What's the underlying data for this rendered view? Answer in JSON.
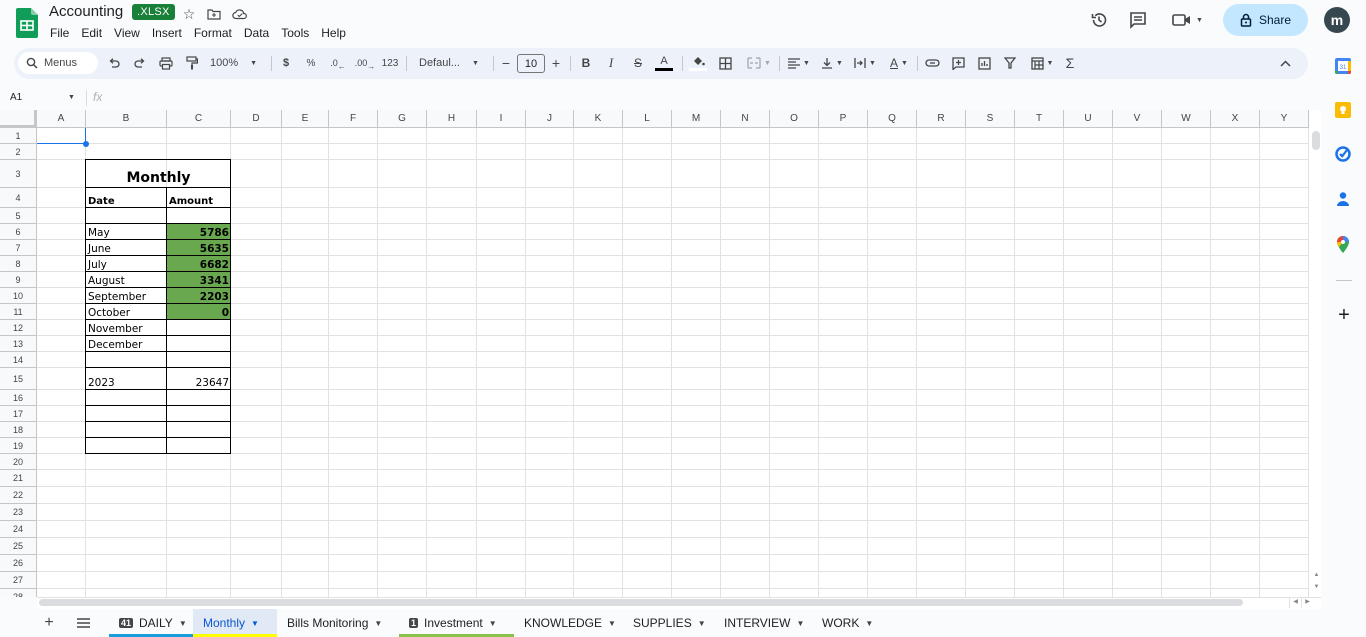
{
  "app": {
    "title": "Accounting",
    "file_badge": ".XLSX",
    "menu": [
      "File",
      "Edit",
      "View",
      "Insert",
      "Format",
      "Data",
      "Tools",
      "Help"
    ],
    "share_label": "Share",
    "avatar_initial": "m"
  },
  "toolbar": {
    "search_label": "Menus",
    "zoom": "100%",
    "currency": "$",
    "percent": "%",
    "decrease_decimal": ".0",
    "increase_decimal": ".00",
    "number_format": "123",
    "font": "Defaul...",
    "font_size": "10"
  },
  "formula_bar": {
    "cell_ref": "A1",
    "fx": "fx",
    "value": ""
  },
  "grid": {
    "columns": [
      "A",
      "B",
      "C",
      "D",
      "E",
      "F",
      "G",
      "H",
      "I",
      "J",
      "K",
      "L",
      "M",
      "N",
      "O",
      "P",
      "Q",
      "R",
      "S",
      "T",
      "U",
      "V",
      "W",
      "X",
      "Y"
    ],
    "rows": [
      "1",
      "2",
      "3",
      "4",
      "5",
      "6",
      "7",
      "8",
      "9",
      "10",
      "11",
      "12",
      "13",
      "14",
      "15",
      "16",
      "17",
      "18",
      "19",
      "20",
      "21",
      "22",
      "23",
      "24",
      "25",
      "26",
      "27",
      "28"
    ],
    "selected_cell": "A1"
  },
  "table": {
    "title": "Monthly",
    "headers": {
      "date": "Date",
      "amount": "Amount"
    },
    "rows": [
      {
        "date": "May",
        "amount": "5786",
        "highlight": true
      },
      {
        "date": "June",
        "amount": "5635",
        "highlight": true
      },
      {
        "date": "July",
        "amount": "6682",
        "highlight": true
      },
      {
        "date": "August",
        "amount": "3341",
        "highlight": true
      },
      {
        "date": "September",
        "amount": "2203",
        "highlight": true
      },
      {
        "date": "October",
        "amount": "0",
        "highlight": true
      },
      {
        "date": "November",
        "amount": "",
        "highlight": false
      },
      {
        "date": "December",
        "amount": "",
        "highlight": false
      }
    ],
    "total": {
      "label": "2023",
      "value": "23647"
    },
    "highlight_color": "#6aa84f"
  },
  "sheet_tabs": [
    {
      "label": "DAILY",
      "badge": "41",
      "color": "#1a9ce0",
      "active": false
    },
    {
      "label": "Monthly",
      "badge": "",
      "color": "#ffff00",
      "active": true
    },
    {
      "label": "Bills Monitoring",
      "badge": "",
      "color": "",
      "active": false
    },
    {
      "label": "Investment",
      "badge": "1",
      "color": "#8bc34a",
      "active": false
    },
    {
      "label": "KNOWLEDGE",
      "badge": "",
      "color": "",
      "active": false
    },
    {
      "label": "SUPPLIES",
      "badge": "",
      "color": "",
      "active": false
    },
    {
      "label": "INTERVIEW",
      "badge": "",
      "color": "",
      "active": false
    },
    {
      "label": "WORK",
      "badge": "",
      "color": "",
      "active": false
    }
  ],
  "side_panel": [
    "calendar",
    "keep",
    "tasks",
    "contacts",
    "maps"
  ],
  "colors": {
    "accent": "#0b57d0",
    "share_bg": "#c2e7ff",
    "sheets_green": "#0f9d58"
  }
}
